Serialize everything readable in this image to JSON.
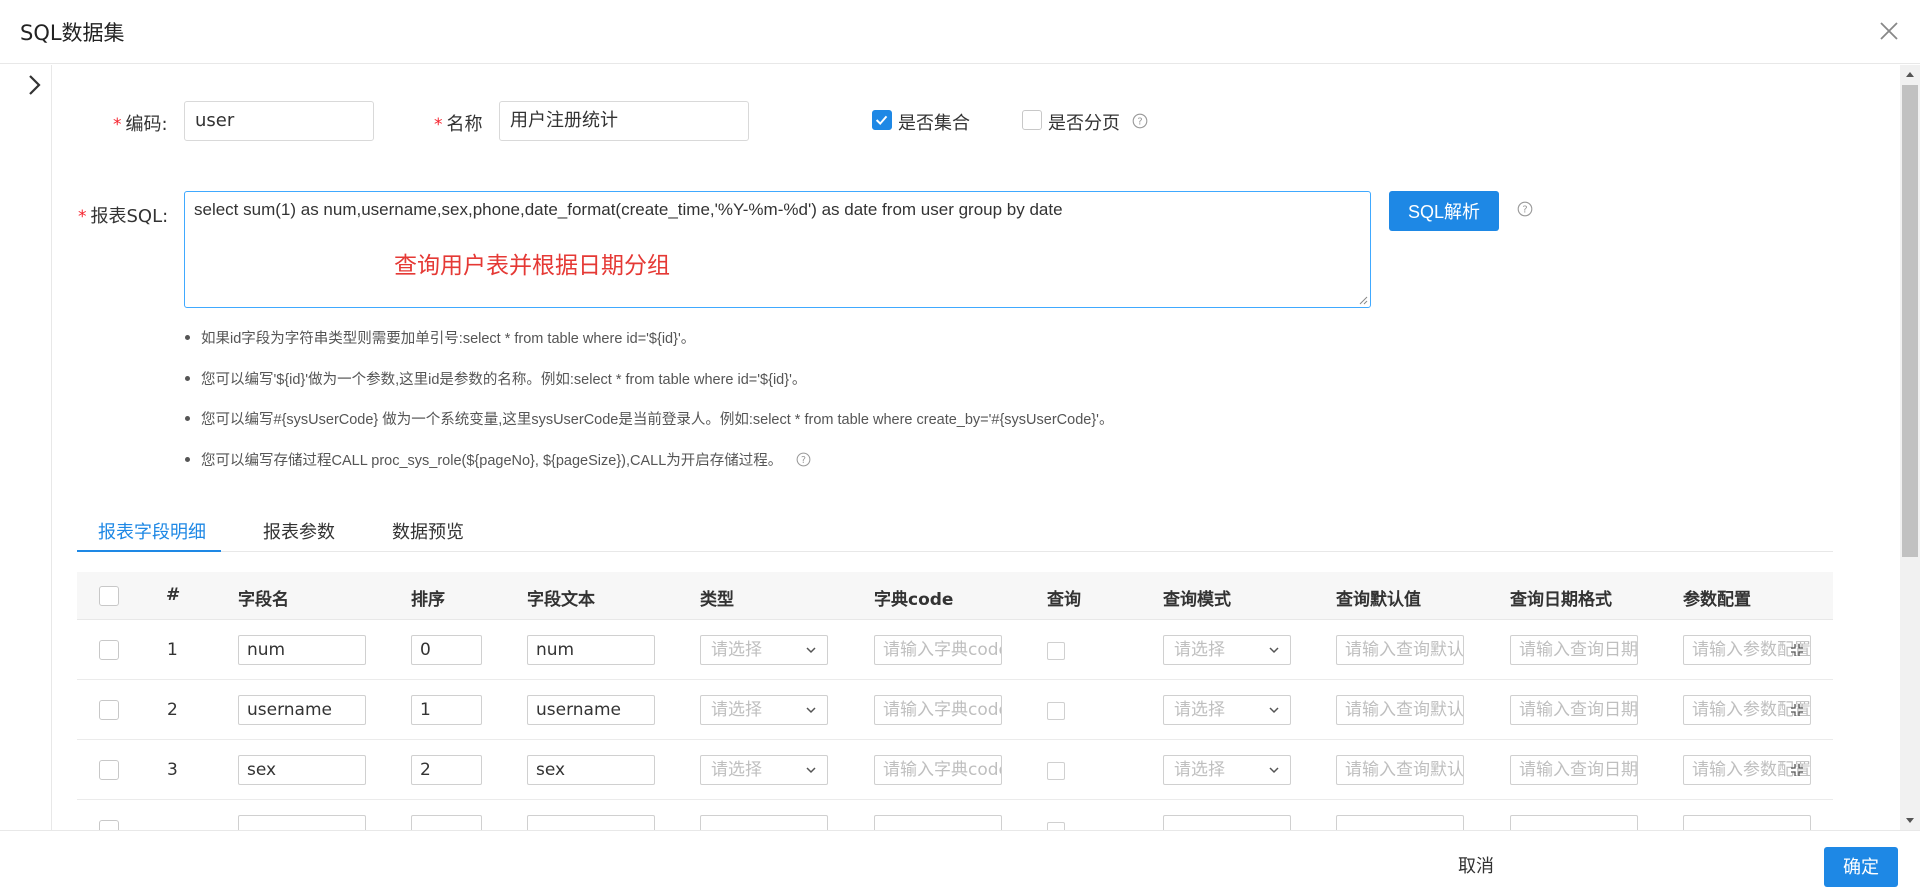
{
  "modal": {
    "title": "SQL数据集"
  },
  "form": {
    "code_label": "编码:",
    "code_value": "user",
    "name_label": "名称",
    "name_value": "用户注册统计",
    "is_collection_label": "是否集合",
    "is_collection_checked": true,
    "is_paged_label": "是否分页",
    "is_paged_checked": false,
    "sql_label": "报表SQL:",
    "sql_value": "select sum(1) as num,username,sex,phone,date_format(create_time,'%Y-%m-%d') as date from user group by date",
    "sql_annotation": "查询用户表并根据日期分组",
    "parse_button": "SQL解析"
  },
  "tips": [
    "如果id字段为字符串类型则需要加单引号:select * from table where id='${id}'。",
    "您可以编写'${id}'做为一个参数,这里id是参数的名称。例如:select * from table where id='${id}'。",
    "您可以编写#{sysUserCode} 做为一个系统变量,这里sysUserCode是当前登录人。例如:select * from table where create_by='#{sysUserCode}'。",
    "您可以编写存储过程CALL proc_sys_role(${pageNo}, ${pageSize}),CALL为开启存储过程。"
  ],
  "tabs": [
    "报表字段明细",
    "报表参数",
    "数据预览"
  ],
  "table": {
    "headers": [
      "#",
      "字段名",
      "排序",
      "字段文本",
      "类型",
      "字典code",
      "查询",
      "查询模式",
      "查询默认值",
      "查询日期格式",
      "参数配置"
    ],
    "placeholders": {
      "type": "请选择",
      "dict_code": "请输入字典code",
      "query_mode": "请选择",
      "query_default": "请输入查询默认值",
      "query_date_format": "请输入查询日期格式",
      "param_config": "请输入参数配置"
    },
    "rows": [
      {
        "index": "1",
        "field_name": "num",
        "order": "0",
        "field_text": "num"
      },
      {
        "index": "2",
        "field_name": "username",
        "order": "1",
        "field_text": "username"
      },
      {
        "index": "3",
        "field_name": "sex",
        "order": "2",
        "field_text": "sex"
      }
    ]
  },
  "footer": {
    "cancel_label": "取消",
    "ok_label": "确定"
  },
  "colors": {
    "primary": "#1e88e5",
    "required": "#f5222d",
    "annotation": "#e53935"
  }
}
